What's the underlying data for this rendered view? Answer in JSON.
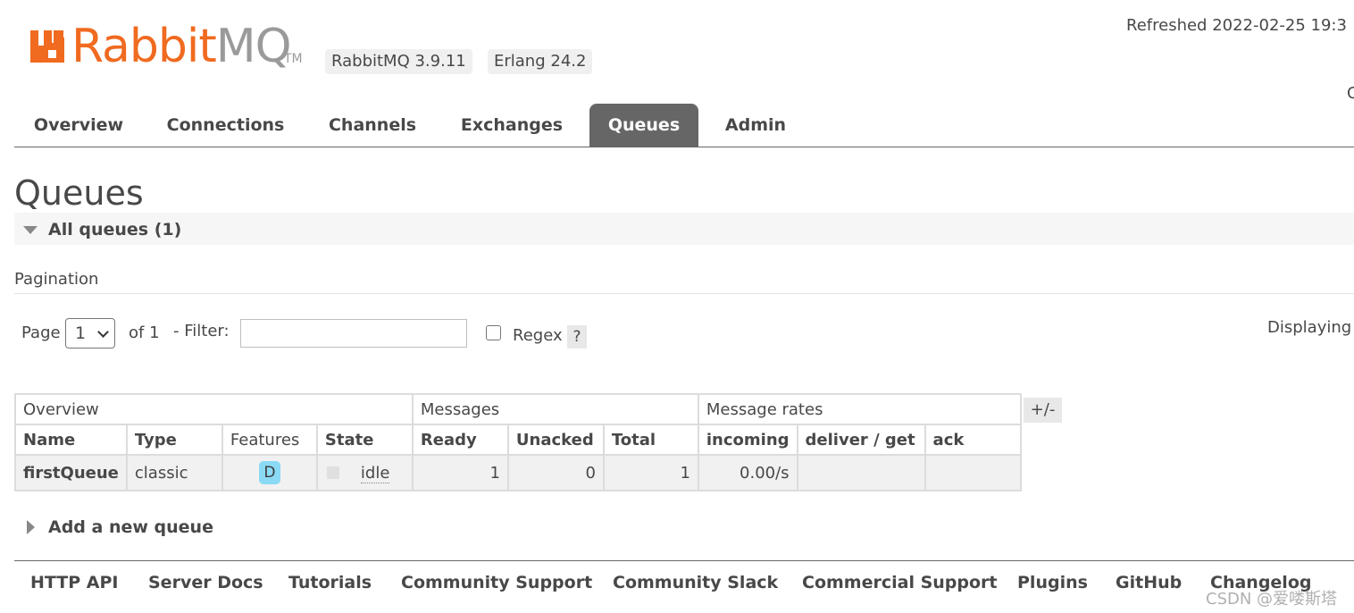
{
  "header": {
    "logo_text_rabbit": "Rabbit",
    "logo_text_mq": "MQ",
    "logo_tm": "TM",
    "rabbitmq_version": "RabbitMQ 3.9.11",
    "erlang_version": "Erlang 24.2",
    "refreshed": "Refreshed 2022-02-25 19:3",
    "right_clip": "C"
  },
  "nav": {
    "tabs": [
      {
        "label": "Overview",
        "active": false
      },
      {
        "label": "Connections",
        "active": false
      },
      {
        "label": "Channels",
        "active": false
      },
      {
        "label": "Exchanges",
        "active": false
      },
      {
        "label": "Queues",
        "active": true
      },
      {
        "label": "Admin",
        "active": false
      }
    ]
  },
  "page": {
    "title": "Queues",
    "section_title": "All queues (1)",
    "pagination_label": "Pagination"
  },
  "controls": {
    "page_label": "Page",
    "page_value": "1",
    "of_label": "of 1",
    "filter_label": "- Filter:",
    "filter_value": "",
    "regex_label": "Regex",
    "regex_checked": false,
    "help_label": "?",
    "displaying": "Displaying"
  },
  "table": {
    "groups": [
      "Overview",
      "Messages",
      "Message rates"
    ],
    "columns": [
      "Name",
      "Type",
      "Features",
      "State",
      "Ready",
      "Unacked",
      "Total",
      "incoming",
      "deliver / get",
      "ack"
    ],
    "rows": [
      {
        "name": "firstQueue",
        "type": "classic",
        "features": "D",
        "state": "idle",
        "ready": "1",
        "unacked": "0",
        "total": "1",
        "incoming": "0.00/s",
        "deliver_get": "",
        "ack": ""
      }
    ],
    "columns_toggle": "+/-"
  },
  "add_queue": {
    "label": "Add a new queue"
  },
  "footer": {
    "links": [
      "HTTP API",
      "Server Docs",
      "Tutorials",
      "Community Support",
      "Community Slack",
      "Commercial Support",
      "Plugins",
      "GitHub",
      "Changelog"
    ]
  },
  "watermark": "CSDN @爱喽斯塔",
  "colors": {
    "brand_orange": "#f06a1f",
    "tab_active_bg": "#666666",
    "feature_badge": "#8adaf5"
  }
}
